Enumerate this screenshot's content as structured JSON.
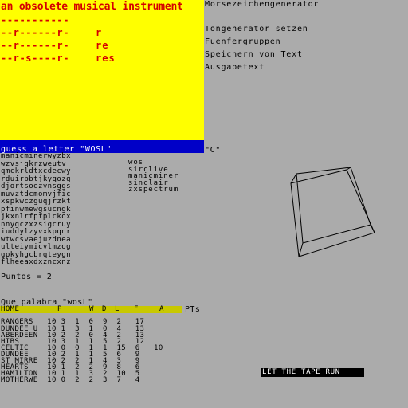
{
  "hangman": {
    "title": "an obsolete musical instrument",
    "dashes": "-----------",
    "rows": [
      {
        "pattern": "--r------r-",
        "word": "r"
      },
      {
        "pattern": "--r------r-",
        "word": "re"
      },
      {
        "pattern": "--r-s----r-",
        "word": "res"
      }
    ]
  },
  "menu": {
    "items": [
      "Morsezeichengenerator",
      "Tongenerator setzen",
      "Fuenfergruppen",
      "Speichern von Text",
      "Ausgabetext"
    ]
  },
  "guess": {
    "prompt": "guess a letter \"WOSL\"",
    "value": "\"C\""
  },
  "wordsearch": {
    "grid": [
      "manicminerwyzbx",
      "wzvsjgkrzweutv",
      "qmckrldtxcdecwy",
      "rduirbbtjkyqozg",
      "djortsoezvnsggs",
      "muvztdcmomvjfic",
      "xspkwczguqjrzkt",
      "pfinwmewgsucngk",
      "jkxnlrfpfplckox",
      "nnygczxzsigcruy",
      "iuddylzyvxkpqnr",
      "wtwcsvaejuzdnea",
      "ulteiymicvlmzog",
      "gpkyhgcbrqteygn",
      "flheeaxdxzncxnz"
    ],
    "words": [
      "wos",
      "sirclive",
      "manicminer",
      "sinclair",
      "zxspectrum"
    ]
  },
  "score": {
    "label": "Puntos = 2",
    "question": "Que palabra \"wosL\""
  },
  "league": {
    "headers": {
      "team": "HOME",
      "p": "P",
      "w": "W",
      "d": "D",
      "l": "L",
      "f": "F",
      "a": "A",
      "pts": "PTs"
    },
    "rows": [
      "RANGERS   10 3  1  0  9  2   17",
      "DUNDEE U  10 1  3  1  0  4   13",
      "ABERDEEN  10 2  2  0  4  2   13",
      "HIBS      10 3  1  1  5  2   12",
      "CELTIC    10 0  0  1  1  15  6   10",
      "DUNDEE    10 2  1  1  5  6   9",
      "ST MIRRE  10 2  2  1  4  3   9",
      "HEARTS    10 1  2  2  9  8   6",
      "HAMILTON  10 1  1  3  2  10  5",
      "MOTHERWE  10 0  2  2  3  7   4"
    ]
  },
  "tape_message": "LET THE TAPE RUN",
  "colors": {
    "background": "#ababab",
    "hangman_panel": "#ffff00",
    "hangman_text": "#d40000",
    "guess_bar": "#0000c8",
    "league_header": "#c8c800"
  }
}
